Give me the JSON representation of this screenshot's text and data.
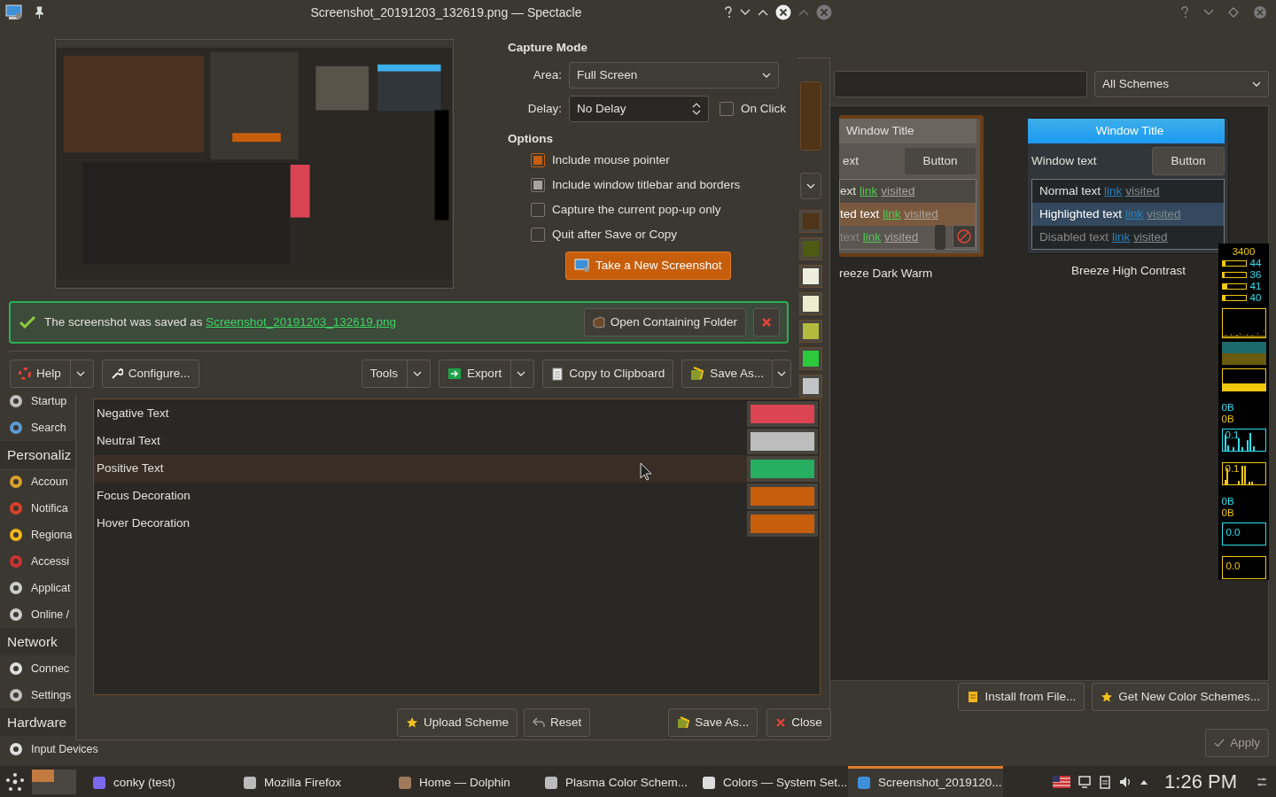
{
  "spectacle": {
    "title": "Screenshot_20191203_132619.png — Spectacle",
    "capture_mode": {
      "heading": "Capture Mode",
      "area_label": "Area:",
      "area": "Full Screen",
      "delay_label": "Delay:",
      "delay": "No Delay",
      "on_click": {
        "label": "On Click",
        "checked": false
      }
    },
    "options": {
      "heading": "Options",
      "items": [
        {
          "label": "Include mouse pointer",
          "checked": true,
          "focused": true
        },
        {
          "label": "Include window titlebar and borders",
          "checked": true,
          "focused": false
        },
        {
          "label": "Capture the current pop-up only",
          "checked": false,
          "focused": false
        },
        {
          "label": "Quit after Save or Copy",
          "checked": false,
          "focused": false
        }
      ]
    },
    "take_button": "Take a New Screenshot",
    "notice": {
      "text": "The screenshot was saved as ",
      "link": "Screenshot_20191203_132619.png",
      "open_button": "Open Containing Folder"
    },
    "toolbar_left": [
      {
        "label": "Help",
        "kind": "menu"
      },
      {
        "label": "Configure...",
        "kind": "plain"
      }
    ],
    "toolbar_right": [
      {
        "label": "Tools",
        "kind": "menu"
      },
      {
        "label": "Export",
        "kind": "menu"
      },
      {
        "label": "Copy to Clipboard",
        "kind": "plain"
      },
      {
        "label": "Save As...",
        "kind": "split"
      }
    ]
  },
  "editor": {
    "upper_swatches": [
      {
        "color": "#4f3417"
      },
      {
        "color": "#4f5a12"
      },
      {
        "color": "#eeeedf"
      },
      {
        "color": "#efeccf"
      },
      {
        "color": "#b3bb3e"
      },
      {
        "color": "#2bc93b"
      },
      {
        "color": "#c3c4c7"
      }
    ],
    "rows": [
      {
        "label": "Negative Text",
        "color": "#da4453",
        "selected": false
      },
      {
        "label": "Neutral Text",
        "color": "#bdbdbd",
        "selected": false
      },
      {
        "label": "Positive Text",
        "color": "#27ae60",
        "selected": true
      },
      {
        "label": "Focus Decoration",
        "color": "#c75e0b",
        "selected": false
      },
      {
        "label": "Hover Decoration",
        "color": "#c75e0b",
        "selected": false
      }
    ],
    "buttons": [
      {
        "label": "Upload Scheme",
        "kind": "upload"
      },
      {
        "label": "Reset",
        "kind": "reset"
      },
      {
        "label": "Save As...",
        "kind": "save"
      },
      {
        "label": "Close",
        "kind": "close"
      }
    ]
  },
  "settings": {
    "sidebar": [
      {
        "kind": "item",
        "label": "Startup"
      },
      {
        "kind": "item",
        "label": "Search"
      },
      {
        "kind": "header",
        "label": "Personaliz"
      },
      {
        "kind": "item",
        "label": "Accoun"
      },
      {
        "kind": "item",
        "label": "Notifica"
      },
      {
        "kind": "item",
        "label": "Regiona"
      },
      {
        "kind": "item",
        "label": "Accessi"
      },
      {
        "kind": "item",
        "label": "Applicat"
      },
      {
        "kind": "item",
        "label": "Online /"
      },
      {
        "kind": "header",
        "label": "Network"
      },
      {
        "kind": "item",
        "label": "Connec"
      },
      {
        "kind": "item",
        "label": "Settings"
      },
      {
        "kind": "header",
        "label": "Hardware"
      },
      {
        "kind": "item",
        "label": "Input Devices"
      }
    ],
    "filter": "All Schemes",
    "schemes": [
      {
        "name": "reeze Dark Warm",
        "selected": true,
        "title": "Window Title",
        "window_text": "ext",
        "button": "Button",
        "rows": [
          {
            "kind": "normal",
            "text": "ext",
            "link": "link",
            "visited": "visited"
          },
          {
            "kind": "highlighted",
            "text": "ted text",
            "link": "link",
            "visited": "visited"
          },
          {
            "kind": "disabled",
            "text": "text",
            "link": "link",
            "visited": "visited"
          }
        ]
      },
      {
        "name": "Breeze High Contrast",
        "selected": false,
        "title": "Window Title",
        "window_text": "Window text",
        "button": "Button",
        "rows": [
          {
            "kind": "normal",
            "text": "Normal text",
            "link": "link",
            "visited": "visited"
          },
          {
            "kind": "highlighted",
            "text": "Highlighted text",
            "link": "link",
            "visited": "visited"
          },
          {
            "kind": "disabled",
            "text": "Disabled text",
            "link": "link",
            "visited": "visited"
          }
        ]
      }
    ],
    "buttons": [
      {
        "label": "Install from File..."
      },
      {
        "label": "Get New Color Schemes..."
      }
    ],
    "apply": {
      "label": "Apply",
      "disabled": true
    }
  },
  "conky": {
    "freq": "3400",
    "cores": [
      {
        "value": "44",
        "level": 0.15
      },
      {
        "value": "36",
        "level": 0.1
      },
      {
        "value": "41",
        "level": 0.2
      },
      {
        "value": "40",
        "level": 0.12
      }
    ],
    "net_a": [
      "0B",
      "0B"
    ],
    "graph_labels": [
      "0.1",
      "0.1"
    ],
    "net_b": [
      "0B",
      "0B"
    ],
    "box_labels": [
      "0.0",
      "0.0"
    ]
  },
  "taskbar": {
    "tasks": [
      {
        "label": "conky (test)",
        "selected": false
      },
      {
        "label": "Mozilla Firefox",
        "selected": false
      },
      {
        "label": "Home — Dolphin",
        "selected": false
      },
      {
        "label": "Plasma Color Schem...",
        "selected": false
      },
      {
        "label": "Colors  — System Set...",
        "selected": false
      },
      {
        "label": "Screenshot_2019120...",
        "selected": true
      }
    ],
    "clock": "1:26 PM"
  }
}
